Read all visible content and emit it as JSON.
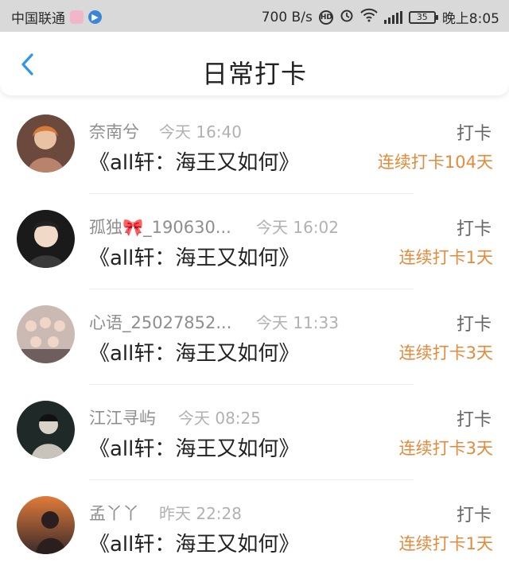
{
  "status_bar": {
    "carrier": "中国联通",
    "speed": "700 B/s",
    "network": "4G",
    "battery": "35",
    "time": "晚上8:05"
  },
  "header": {
    "title": "日常打卡",
    "back_icon": "chevron-left-icon",
    "accent_color": "#2f96e8"
  },
  "checkins": [
    {
      "name": "奈南兮",
      "time": "今天 16:40",
      "book": "《all轩：海王又如何》",
      "action": "打卡",
      "streak": "连续打卡104天"
    },
    {
      "name": "孤独🎀_190630...",
      "time": "今天 16:02",
      "book": "《all轩：海王又如何》",
      "action": "打卡",
      "streak": "连续打卡1天"
    },
    {
      "name": "心语_25027852...",
      "time": "今天 11:33",
      "book": "《all轩：海王又如何》",
      "action": "打卡",
      "streak": "连续打卡3天"
    },
    {
      "name": "江江寻屿",
      "time": "今天 08:25",
      "book": "《all轩：海王又如何》",
      "action": "打卡",
      "streak": "连续打卡3天"
    },
    {
      "name": "孟丫丫",
      "time": "昨天 22:28",
      "book": "《all轩：海王又如何》",
      "action": "打卡",
      "streak": "连续打卡1天"
    }
  ],
  "colors": {
    "streak": "#e58a3b",
    "status_bar_bg": "#d9d9d9"
  }
}
